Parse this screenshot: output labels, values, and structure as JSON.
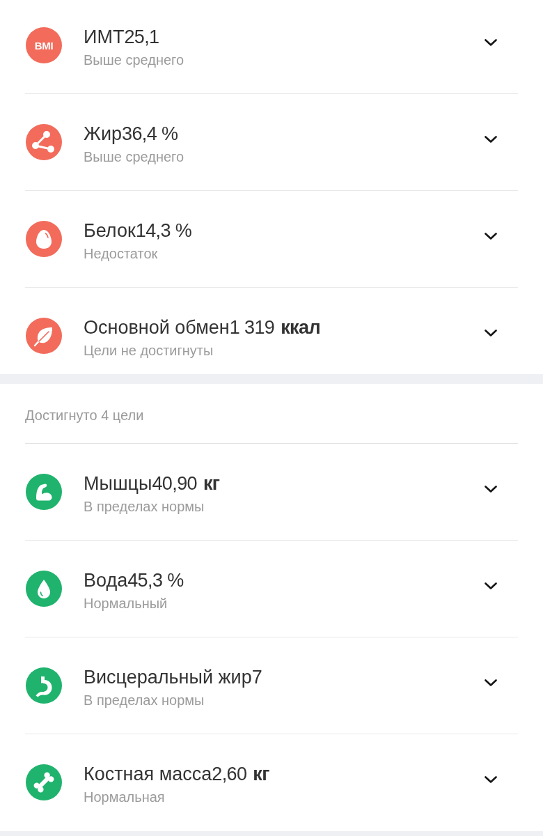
{
  "sections": [
    {
      "color": "#f26b5b",
      "items": [
        {
          "kind": "bmi",
          "icon_label": "BMI",
          "name": "ИМТ",
          "value": "25,1",
          "status": "Выше среднего",
          "expanded": false
        },
        {
          "kind": "molecule",
          "name": "Жир",
          "value": "36,4 %",
          "status": "Выше среднего",
          "expanded": false
        },
        {
          "kind": "egg",
          "name": "Белок",
          "value": "14,3 %",
          "status": "Недостаток",
          "expanded": false
        },
        {
          "kind": "leaf",
          "name": "Основной обмен",
          "value": "1 319 **ккал**",
          "status": "Цели не достигнуты",
          "expanded": false
        }
      ]
    },
    {
      "header": "Достигнуто 4 цели",
      "color": "#1fb36d",
      "items": [
        {
          "kind": "muscle",
          "name": "Мышцы",
          "value": "40,90 **кг**",
          "status": "В пределах нормы",
          "expanded": false
        },
        {
          "kind": "drop",
          "name": "Вода",
          "value": "45,3 %",
          "status": "Нормальный",
          "expanded": false
        },
        {
          "kind": "stomach",
          "name": "Висцеральный жир",
          "value": "7",
          "status": "В пределах нормы",
          "expanded": false
        },
        {
          "kind": "bone",
          "name": "Костная масса",
          "value": "2,60 **кг**",
          "status": "Нормальная",
          "expanded": false
        }
      ]
    }
  ]
}
